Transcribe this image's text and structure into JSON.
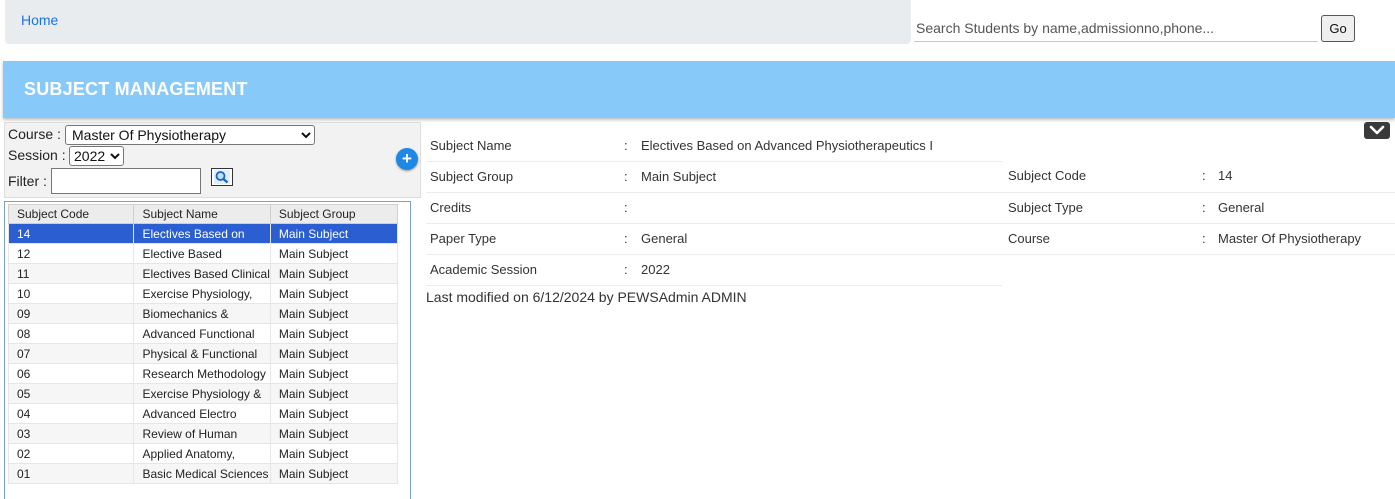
{
  "nav": {
    "home_label": "Home"
  },
  "search": {
    "placeholder": "Search Students by name,admissionno,phone...",
    "go_label": "Go"
  },
  "page_title": "SUBJECT MANAGEMENT",
  "filters": {
    "course_label": "Course :",
    "course_value": "Master Of Physiotherapy",
    "session_label": "Session :",
    "session_value": "2022",
    "filter_label": "Filter :",
    "filter_value": ""
  },
  "icons": {
    "search": "search-icon",
    "add": "plus-circle-icon",
    "collapse": "chevron-down-icon"
  },
  "colors": {
    "banner": "#87c9f9",
    "selected_row": "#2b5fd1",
    "link": "#1a73e8"
  },
  "table": {
    "headers": [
      "Subject Code",
      "Subject Name",
      "Subject Group"
    ],
    "rows": [
      [
        "14",
        "Electives Based on",
        "Main Subject"
      ],
      [
        "12",
        "Elective Based",
        "Main Subject"
      ],
      [
        "11",
        "Electives Based Clinical",
        "Main Subject"
      ],
      [
        "10",
        "Exercise Physiology,",
        "Main Subject"
      ],
      [
        "09",
        "Biomechanics &",
        "Main Subject"
      ],
      [
        "08",
        "Advanced Functional",
        "Main Subject"
      ],
      [
        "07",
        "Physical & Functional",
        "Main Subject"
      ],
      [
        "06",
        "Research Methodology",
        "Main Subject"
      ],
      [
        "05",
        "Exercise Physiology &",
        "Main Subject"
      ],
      [
        "04",
        "Advanced Electro",
        "Main Subject"
      ],
      [
        "03",
        "Review of Human",
        "Main Subject"
      ],
      [
        "02",
        "Applied Anatomy,",
        "Main Subject"
      ],
      [
        "01",
        "Basic Medical Sciences",
        "Main Subject"
      ]
    ]
  },
  "details": {
    "subject_name_label": "Subject Name",
    "subject_name": "Electives Based on Advanced Physiotherapeutics I",
    "subject_group_label": "Subject Group",
    "subject_group": "Main Subject",
    "credits_label": "Credits",
    "credits": "",
    "paper_type_label": "Paper Type",
    "paper_type": "General",
    "academic_session_label": "Academic Session",
    "academic_session": "2022",
    "subject_code_label": "Subject Code",
    "subject_code": "14",
    "subject_type_label": "Subject Type",
    "subject_type": "General",
    "course_label": "Course",
    "course": "Master Of Physiotherapy",
    "separator": ":"
  },
  "last_modified": "Last modified on 6/12/2024 by PEWSAdmin ADMIN"
}
